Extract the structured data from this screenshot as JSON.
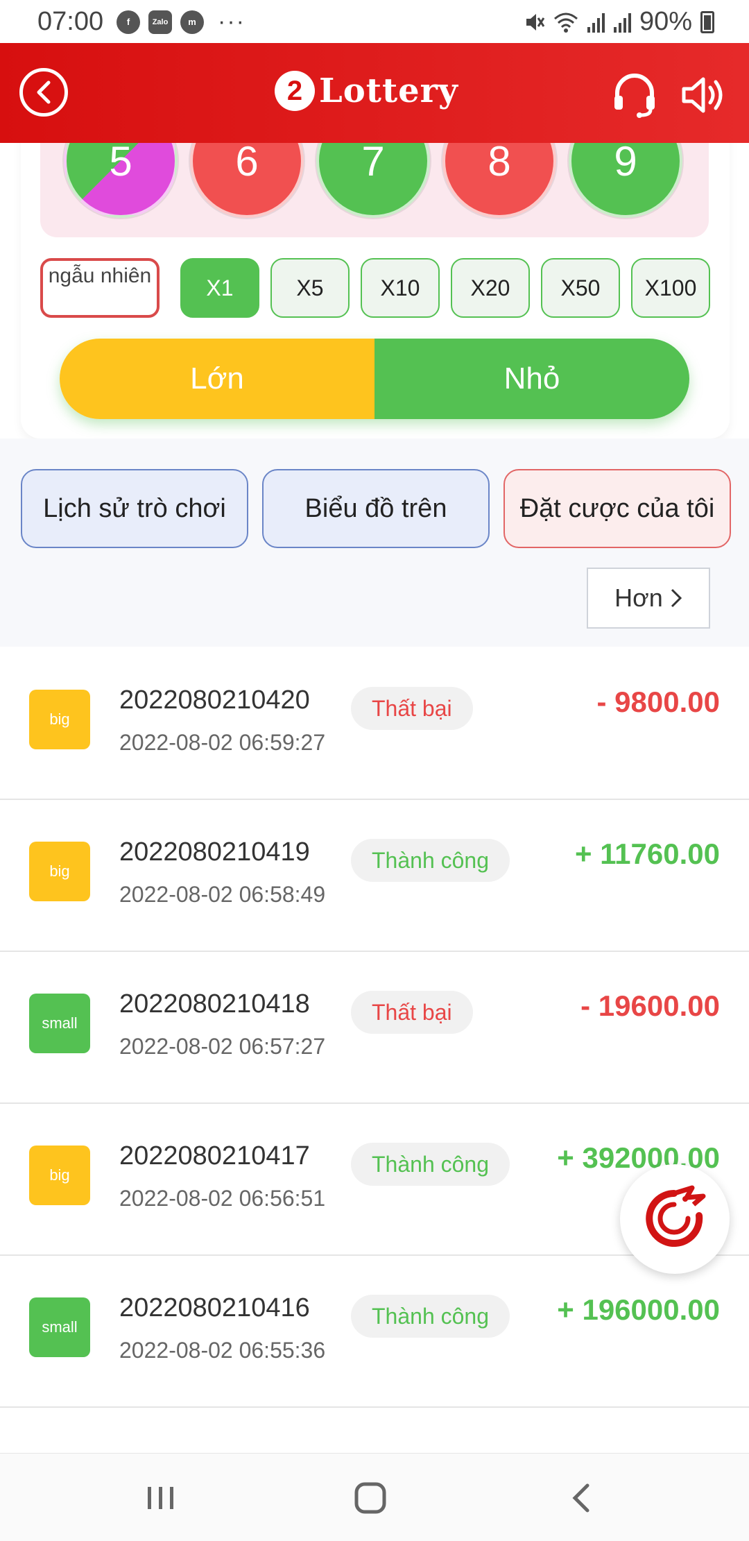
{
  "status_bar": {
    "time": "07:00",
    "apps": [
      "f",
      "Zalo",
      "m"
    ],
    "dots": "···",
    "battery": "90%",
    "icons": [
      "mute-icon",
      "wifi-icon",
      "signal-icon",
      "signal-icon",
      "battery-icon"
    ]
  },
  "header": {
    "logo_badge": "2",
    "logo_text": "Lottery",
    "icons": [
      "back-icon",
      "headset-icon",
      "speaker-icon"
    ]
  },
  "balls": [
    {
      "number": "5",
      "color": "mix"
    },
    {
      "number": "6",
      "color": "red"
    },
    {
      "number": "7",
      "color": "green"
    },
    {
      "number": "8",
      "color": "red"
    },
    {
      "number": "9",
      "color": "green"
    }
  ],
  "bet_controls": {
    "random_label": "ngẫu nhiên",
    "multipliers": [
      "X1",
      "X5",
      "X10",
      "X20",
      "X50",
      "X100"
    ],
    "active_multiplier": "X1",
    "big_label": "Lớn",
    "small_label": "Nhỏ"
  },
  "tabs": [
    {
      "label": "Lịch sử trò chơi"
    },
    {
      "label": "Biểu đồ trên"
    },
    {
      "label": "Đặt cược của tôi"
    }
  ],
  "more_label": "Hơn",
  "bets": [
    {
      "type": "big",
      "period": "2022080210420",
      "time": "2022-08-02 06:59:27",
      "status": "Thất bại",
      "result": "fail",
      "amount": "- 9800.00"
    },
    {
      "type": "big",
      "period": "2022080210419",
      "time": "2022-08-02 06:58:49",
      "status": "Thành công",
      "result": "ok",
      "amount": "+ 11760.00"
    },
    {
      "type": "small",
      "period": "2022080210418",
      "time": "2022-08-02 06:57:27",
      "status": "Thất bại",
      "result": "fail",
      "amount": "- 19600.00"
    },
    {
      "type": "big",
      "period": "2022080210417",
      "time": "2022-08-02 06:56:51",
      "status": "Thành công",
      "result": "ok",
      "amount": "+ 392000.00"
    },
    {
      "type": "small",
      "period": "2022080210416",
      "time": "2022-08-02 06:55:36",
      "status": "Thành công",
      "result": "ok",
      "amount": "+ 196000.00"
    }
  ],
  "colors": {
    "header_red": "#d70f0f",
    "green": "#54c152",
    "red": "#f15050",
    "yellow": "#fec41e",
    "magenta": "#e04bdc"
  }
}
